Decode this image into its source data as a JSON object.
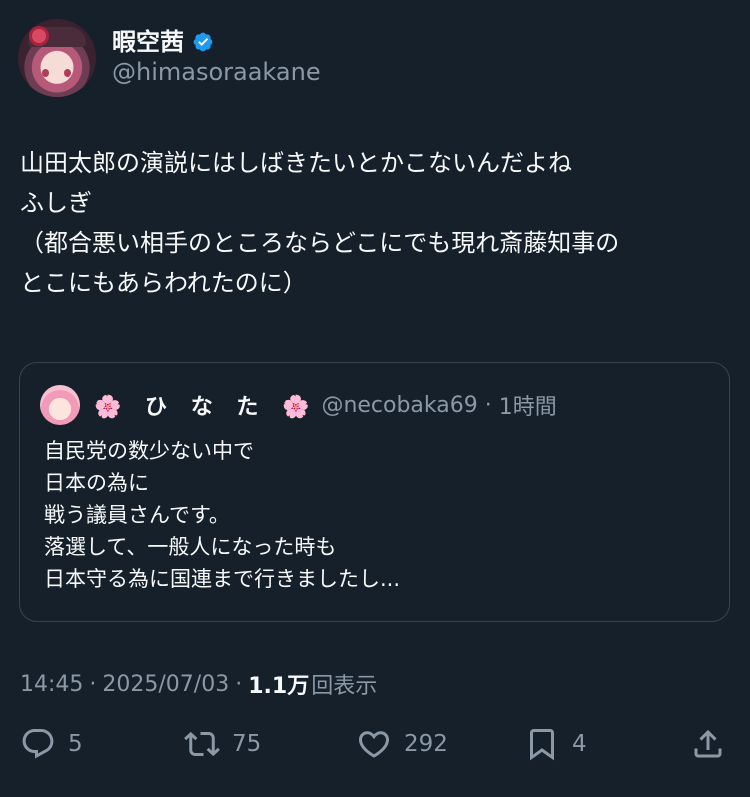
{
  "author": {
    "display_name": "暇空茜",
    "handle": "@himasoraakane",
    "verified_color": "#1d9bf0"
  },
  "tweet": {
    "lines": [
      "山田太郎の演説にはしばきたいとかこないんだよね",
      "ふしぎ",
      "（都合悪い相手のところならどこにでも現れ斎藤知事の",
      "とこにもあらわれたのに）"
    ]
  },
  "quote": {
    "name": "🌸 ひ な た 🌸",
    "handle": "@necobaka69",
    "time": "1時間",
    "lines": [
      "自民党の数少ない中で",
      "日本の為に",
      "戦う議員さんです。",
      "落選して、一般人になった時も",
      "日本守る為に国連まで行きましたし..."
    ]
  },
  "meta": {
    "time": "14:45",
    "date": "2025/07/03",
    "views_count": "1.1万",
    "views_label": "回表示"
  },
  "actions": {
    "replies": "5",
    "retweets": "75",
    "likes": "292",
    "bookmarks": "4"
  },
  "icons": {
    "reply": "reply-icon",
    "retweet": "retweet-icon",
    "like": "heart-icon",
    "bookmark": "bookmark-icon",
    "share": "share-icon"
  },
  "colors": {
    "background": "#15202b",
    "text": "#f7f9f9",
    "secondary": "#8b98a5",
    "border": "#38444d"
  }
}
